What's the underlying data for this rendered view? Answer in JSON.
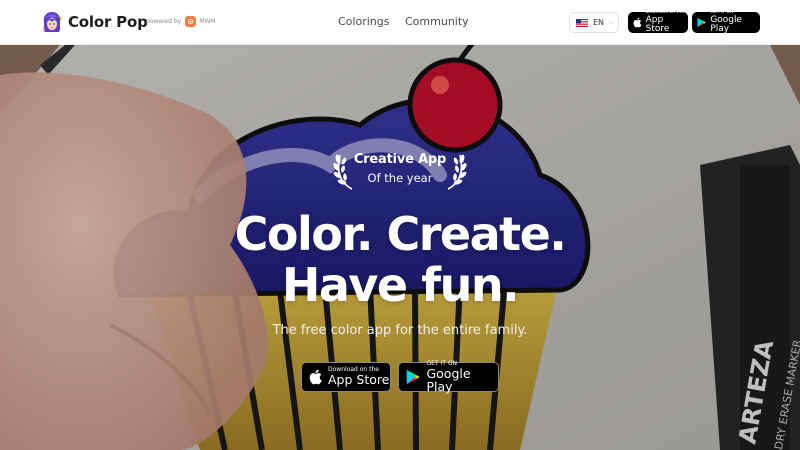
{
  "brand": {
    "name": "Color Pop",
    "powered_by": "powered by",
    "partner": "MWM",
    "logo_icon": "girl-face-logo-icon"
  },
  "nav": {
    "items": [
      {
        "label": "Colorings"
      },
      {
        "label": "Community"
      }
    ]
  },
  "language": {
    "selected": "EN",
    "flag_icon": "us-flag-icon"
  },
  "stores": {
    "app_store": {
      "small": "Download on the",
      "big": "App Store"
    },
    "google_play": {
      "small": "GET IT ON",
      "big": "Google Play"
    }
  },
  "hero": {
    "award_title": "Creative App",
    "award_sub": "Of the year",
    "headline_1": "Color. Create.",
    "headline_2": "Have fun.",
    "tagline": "The free color app for the entire family."
  },
  "colors": {
    "mwm_accent": "#ff7a45",
    "store_button": "#000000",
    "headline": "#ffffff"
  }
}
